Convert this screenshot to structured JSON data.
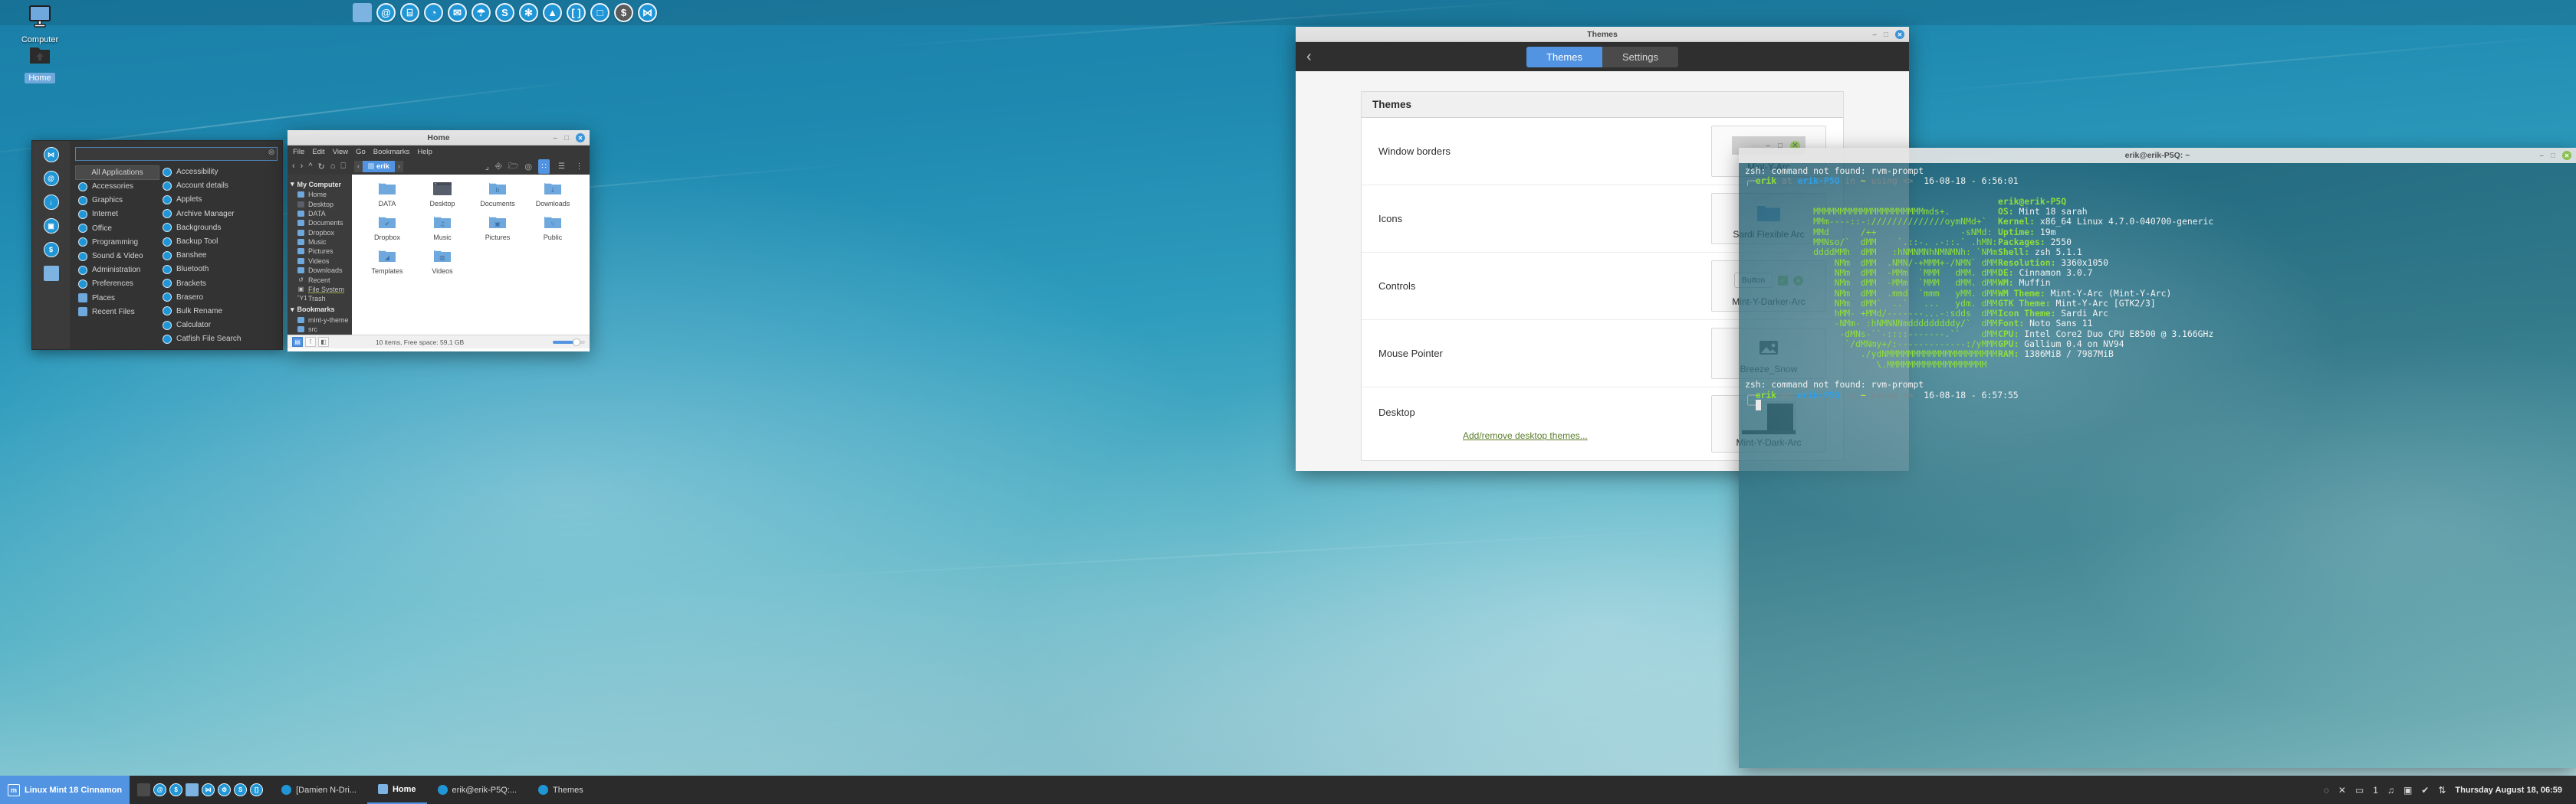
{
  "desktop": {
    "icons": [
      {
        "name": "Computer",
        "icon": "computer-icon",
        "selected": false
      },
      {
        "name": "Home",
        "icon": "home-folder-icon",
        "selected": true
      }
    ]
  },
  "top_panel": {
    "launchers": [
      {
        "name": "files-launcher",
        "glyph": "",
        "style": "folder"
      },
      {
        "name": "firefox-launcher",
        "glyph": "@"
      },
      {
        "name": "usb-launcher",
        "glyph": "⌸"
      },
      {
        "name": "wifi-launcher",
        "glyph": "◔"
      },
      {
        "name": "thunderbird-launcher",
        "glyph": "✉"
      },
      {
        "name": "inkscape-launcher",
        "glyph": "☂"
      },
      {
        "name": "skype-launcher",
        "glyph": "S"
      },
      {
        "name": "pinwheel-launcher",
        "glyph": "✻"
      },
      {
        "name": "audacity-launcher",
        "glyph": "▲"
      },
      {
        "name": "brackets-launcher",
        "glyph": "[ ]"
      },
      {
        "name": "screenshot-launcher",
        "glyph": "□"
      },
      {
        "name": "terminal-launcher",
        "glyph": "$",
        "style": "dark"
      },
      {
        "name": "bowtie-launcher",
        "glyph": "⋈"
      }
    ]
  },
  "app_menu": {
    "search": {
      "value": "",
      "placeholder": ""
    },
    "favorites": [
      {
        "name": "bowtie-fav",
        "glyph": "⋈"
      },
      {
        "name": "firefox-fav",
        "glyph": "@"
      },
      {
        "name": "download-fav",
        "glyph": "↓"
      },
      {
        "name": "screenshot-fav",
        "glyph": "▣"
      },
      {
        "name": "terminal-fav",
        "glyph": "$"
      },
      {
        "name": "files-fav",
        "glyph": "",
        "style": "folder"
      }
    ],
    "categories": [
      {
        "label": "All Applications",
        "icon": "all-applications-icon",
        "active": true
      },
      {
        "label": "Accessories",
        "icon": "accessories-icon"
      },
      {
        "label": "Graphics",
        "icon": "graphics-icon"
      },
      {
        "label": "Internet",
        "icon": "internet-icon"
      },
      {
        "label": "Office",
        "icon": "office-icon"
      },
      {
        "label": "Programming",
        "icon": "programming-icon"
      },
      {
        "label": "Sound & Video",
        "icon": "sound-video-icon"
      },
      {
        "label": "Administration",
        "icon": "administration-icon"
      },
      {
        "label": "Preferences",
        "icon": "preferences-icon"
      },
      {
        "label": "Places",
        "icon": "places-folder-icon",
        "style": "folder"
      },
      {
        "label": "Recent Files",
        "icon": "recent-files-icon",
        "style": "folder"
      }
    ],
    "applications": [
      {
        "label": "Accessibility",
        "icon": "accessibility-icon"
      },
      {
        "label": "Account details",
        "icon": "account-details-icon"
      },
      {
        "label": "Applets",
        "icon": "applets-icon"
      },
      {
        "label": "Archive Manager",
        "icon": "archive-manager-icon"
      },
      {
        "label": "Backgrounds",
        "icon": "backgrounds-icon"
      },
      {
        "label": "Backup Tool",
        "icon": "backup-tool-icon"
      },
      {
        "label": "Banshee",
        "icon": "banshee-icon"
      },
      {
        "label": "Bluetooth",
        "icon": "bluetooth-icon"
      },
      {
        "label": "Brackets",
        "icon": "brackets-icon"
      },
      {
        "label": "Brasero",
        "icon": "brasero-icon"
      },
      {
        "label": "Bulk Rename",
        "icon": "bulk-rename-icon"
      },
      {
        "label": "Calculator",
        "icon": "calculator-icon"
      },
      {
        "label": "Catfish File Search",
        "icon": "catfish-icon"
      }
    ]
  },
  "file_manager": {
    "title": "Home",
    "menubar": [
      "File",
      "Edit",
      "View",
      "Go",
      "Bookmarks",
      "Help"
    ],
    "breadcrumb_current": "erik",
    "toolbar_icons": [
      "back-icon",
      "forward-icon",
      "up-icon",
      "reload-icon",
      "home-icon",
      "computer-icon"
    ],
    "toolbar_right_icons": [
      "show-hidden-icon",
      "open-terminal-icon",
      "new-folder-icon",
      "location-icon"
    ],
    "view_buttons": [
      {
        "name": "icon-view-button",
        "glyph": "∷",
        "active": true
      },
      {
        "name": "list-view-button",
        "glyph": "☰",
        "active": false
      },
      {
        "name": "compact-view-button",
        "glyph": "⁙",
        "active": false
      }
    ],
    "sidebar": [
      {
        "label": "My Computer",
        "type": "header"
      },
      {
        "label": "Home",
        "icon": "home-icon"
      },
      {
        "label": "Desktop",
        "icon": "desktop-icon",
        "style": "grey"
      },
      {
        "label": "DATA",
        "icon": "data-folder-icon"
      },
      {
        "label": "Documents",
        "icon": "documents-icon"
      },
      {
        "label": "Dropbox",
        "icon": "dropbox-icon"
      },
      {
        "label": "Music",
        "icon": "music-icon"
      },
      {
        "label": "Pictures",
        "icon": "pictures-icon"
      },
      {
        "label": "Videos",
        "icon": "videos-icon"
      },
      {
        "label": "Downloads",
        "icon": "downloads-icon"
      },
      {
        "label": "Recent",
        "icon": "recent-icon",
        "style": "plain",
        "glyph": "↺"
      },
      {
        "label": "File System",
        "icon": "file-system-icon",
        "style": "plain",
        "glyph": "▣",
        "underline": true
      },
      {
        "label": "Trash",
        "icon": "trash-icon",
        "style": "plain",
        "glyph": "Ὕ1"
      },
      {
        "label": "Bookmarks",
        "type": "header"
      },
      {
        "label": "mint-y-theme",
        "icon": "mint-y-theme-folder-icon"
      },
      {
        "label": "src",
        "icon": "src-folder-icon"
      }
    ],
    "files": [
      {
        "label": "DATA",
        "icon": "folder-icon",
        "glyph": ""
      },
      {
        "label": "Desktop",
        "icon": "desktop-folder-icon",
        "glyph": ""
      },
      {
        "label": "Documents",
        "icon": "documents-folder-icon",
        "glyph": "὜b"
      },
      {
        "label": "Downloads",
        "icon": "downloads-folder-icon",
        "glyph": "↓"
      },
      {
        "label": "Dropbox",
        "icon": "dropbox-folder-icon",
        "glyph": "✔"
      },
      {
        "label": "Music",
        "icon": "music-folder-icon",
        "glyph": "♫"
      },
      {
        "label": "Pictures",
        "icon": "pictures-folder-icon",
        "glyph": "▣"
      },
      {
        "label": "Public",
        "icon": "public-folder-icon",
        "glyph": "⑂"
      },
      {
        "label": "Templates",
        "icon": "templates-folder-icon",
        "glyph": "◢"
      },
      {
        "label": "Videos",
        "icon": "videos-folder-icon",
        "glyph": "▥"
      }
    ],
    "status": "10 items, Free space: 59,1 GB",
    "status_buttons": [
      {
        "name": "icon-toggle-button",
        "glyph": "▤",
        "active": true
      },
      {
        "name": "tree-toggle-button",
        "glyph": "⑂",
        "active": false
      },
      {
        "name": "pane-toggle-button",
        "glyph": "◧",
        "active": false
      }
    ]
  },
  "themes_window": {
    "title": "Themes",
    "back_icon": "back-chevron-icon",
    "tabs": [
      {
        "label": "Themes",
        "active": true
      },
      {
        "label": "Settings",
        "active": false
      }
    ],
    "card_title": "Themes",
    "add_remove_link": "Add/remove desktop themes...",
    "rows": [
      {
        "label": "Window borders",
        "value": "Mint-Y-Arc",
        "preview": "window-borders-preview"
      },
      {
        "label": "Icons",
        "value": "Sardi Flexible Arc",
        "preview": "icons-preview"
      },
      {
        "label": "Controls",
        "value": "Mint-Y-Darker-Arc",
        "preview": "controls-preview",
        "button_label": "Button"
      },
      {
        "label": "Mouse Pointer",
        "value": "Breeze_Snow",
        "preview": "mouse-pointer-preview"
      },
      {
        "label": "Desktop",
        "value": "Mint-Y-Dark-Arc",
        "preview": "desktop-preview"
      }
    ]
  },
  "terminal": {
    "title": "erik@erik-P5Q: ~",
    "scrollback": [
      {
        "type": "err",
        "text": "zsh: command not found: rvm-prompt"
      },
      {
        "type": "prompt",
        "user": "erik",
        "at": "at",
        "host": "erik-P5Q",
        "in": "in",
        "dir": "~",
        "using": "using",
        "sep": "<>",
        "date": "16-08-18",
        "dash": "-",
        "time": "6:56:01"
      }
    ],
    "neofetch": {
      "header": "erik@erik-P5Q",
      "fields": [
        {
          "key": "OS",
          "value": "Mint 18 sarah"
        },
        {
          "key": "Kernel",
          "value": "x86_64 Linux 4.7.0-040700-generic"
        },
        {
          "key": "Uptime",
          "value": "19m"
        },
        {
          "key": "Packages",
          "value": "2550"
        },
        {
          "key": "Shell",
          "value": "zsh 5.1.1"
        },
        {
          "key": "Resolution",
          "value": "3360x1050"
        },
        {
          "key": "DE",
          "value": "Cinnamon 3.0.7"
        },
        {
          "key": "WM",
          "value": "Muffin"
        },
        {
          "key": "WM Theme",
          "value": "Mint-Y-Arc (Mint-Y-Arc)"
        },
        {
          "key": "GTK Theme",
          "value": "Mint-Y-Arc [GTK2/3]"
        },
        {
          "key": "Icon Theme",
          "value": "Sardi Arc"
        },
        {
          "key": "Font",
          "value": "Noto Sans 11"
        },
        {
          "key": "CPU",
          "value": "Intel Core2 Duo CPU E8500 @ 3.166GHz"
        },
        {
          "key": "GPU",
          "value": "Gallium 0.4 on NV94"
        },
        {
          "key": "RAM",
          "value": "1386MiB / 7987MiB"
        }
      ],
      "ascii": [
        "             MMMMMMMMMMMMMMMMMMMMMmds+.",
        "             MMm----::-://////////////oymNMd+`",
        "             MMd      /++                -sNMd:",
        "             MMNso/`  dMM    `.::-. .-::.` .hMN:",
        "             ddddMMh  dMM   :hNMNMNhNMNMNh: `NMm",
        "                 NMm  dMM  .NMN/-+MMM+-/NMN` dMM",
        "                 NMm  dMM  -MMm  `MMM   dMM. dMM",
        "                 NMm  dMM  -MMm  `MMM   dMM. dMM",
        "                 NMm  dMM  .mmd  `mmm   yMM. dMM",
        "                 NMm  dMM`  ..`   ...   ydm. dMM",
        "                 hMM- +MMd/-------...-:sdds  dMM",
        "                 -NMm- :hNMNNNmdddddddddy/`  dMM",
        "                  -dMNs-``-::::-------.``    dMM",
        "                   `/dMNmy+/:-------------:/yMMM",
        "                      ./ydNMMMMMMMMMMMMMMMMMMMMM",
        "                         \\.MMMMMMMMMMMMMMMMMMM"
      ]
    },
    "bottom": [
      {
        "type": "err",
        "text": "zsh: command not found: rvm-prompt"
      },
      {
        "type": "prompt",
        "user": "erik",
        "at": "at",
        "host": "erik-P5Q",
        "in": "in",
        "dir": "~",
        "using": "using",
        "sep": "<>",
        "date": "16-08-18",
        "dash": "-",
        "time": "6:57:55"
      }
    ]
  },
  "bottom_panel": {
    "menu_label": "Linux Mint 18 Cinnamon",
    "launchers": [
      {
        "name": "show-desktop-button",
        "glyph": "",
        "style": "plain"
      },
      {
        "name": "firefox-task-launcher",
        "glyph": "@"
      },
      {
        "name": "terminal-task-launcher",
        "glyph": "$"
      },
      {
        "name": "files-task-launcher",
        "glyph": "",
        "style": "folder"
      },
      {
        "name": "bowtie-task-launcher",
        "glyph": "⋈"
      },
      {
        "name": "settings-task-launcher",
        "glyph": "⚙"
      },
      {
        "name": "skype-task-launcher",
        "glyph": "S"
      },
      {
        "name": "brackets-task-launcher",
        "glyph": "[]"
      }
    ],
    "tasks": [
      {
        "label": "[Damien N-Dri...",
        "icon": "spotify-icon",
        "active": false
      },
      {
        "label": "Home",
        "icon": "folder-icon",
        "active": true
      },
      {
        "label": "erik@erik-P5Q:...",
        "icon": "terminal-icon",
        "active": false
      },
      {
        "label": "Themes",
        "icon": "themes-icon",
        "active": false
      }
    ],
    "tray": [
      {
        "name": "sync-icon",
        "glyph": "◌"
      },
      {
        "name": "close-icon",
        "glyph": "✕"
      },
      {
        "name": "messages-icon",
        "glyph": "▭"
      },
      {
        "name": "messages-count",
        "glyph": "1"
      },
      {
        "name": "music-icon",
        "glyph": "♫"
      },
      {
        "name": "screenshot-tray-icon",
        "glyph": "▣"
      },
      {
        "name": "shield-icon",
        "glyph": "✔"
      },
      {
        "name": "network-icon",
        "glyph": "⇅"
      }
    ],
    "clock": "Thursday August 18, 06:59"
  }
}
